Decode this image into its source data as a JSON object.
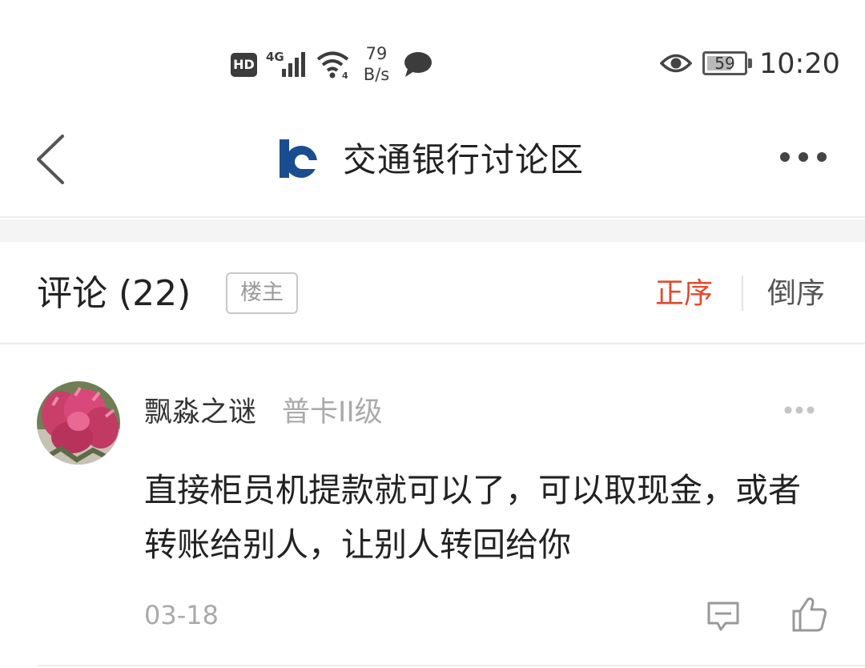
{
  "status_bar": {
    "hd_label": "HD",
    "network_label": "4G",
    "speed_value": "79",
    "speed_unit": "B/s",
    "battery": "59",
    "battery_fraction": 0.59,
    "time": "10:20",
    "icons": [
      "hd-icon",
      "signal-icon",
      "wifi-icon",
      "chat-bubble-icon",
      "eye-icon",
      "battery-icon"
    ]
  },
  "nav": {
    "title": "交通银行讨论区",
    "icons": [
      "back-icon",
      "bank-logo-icon",
      "more-icon"
    ]
  },
  "comments_header": {
    "title": "评论 (22)",
    "owner_filter": "楼主",
    "sort_asc": "正序",
    "sort_desc": "倒序",
    "active_color": "#e04b2f"
  },
  "comment": {
    "username": "飘淼之谜",
    "level": "普卡II级",
    "text": "直接柜员机提款就可以了，可以取现金，或者转账给别人，让别人转回给你",
    "date": "03-18",
    "icons": [
      "more-dots-icon",
      "reply-icon",
      "like-icon"
    ]
  },
  "colors": {
    "accent": "#e04b2f",
    "logo_blue": "#1a4d8f",
    "muted": "#aaaaaa"
  }
}
